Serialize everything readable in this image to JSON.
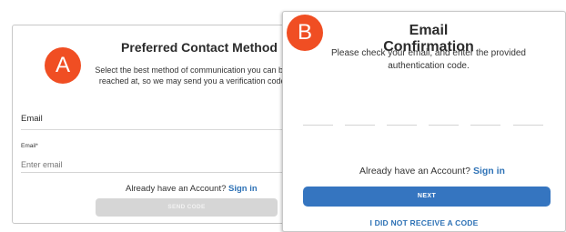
{
  "badges": {
    "a": "A",
    "b": "B"
  },
  "contact_method": {
    "title": "Preferred Contact Method",
    "description": "Select the best method of communication you can be reached at, so we may send you a verification code:",
    "selected_method": "Email",
    "email_field": {
      "label": "Email*",
      "placeholder": "Enter email",
      "value": ""
    },
    "account_prompt": "Already have an Account?",
    "sign_in_link": "Sign in",
    "send_code_button": "SEND CODE"
  },
  "email_confirmation": {
    "title": "Email Confirmation",
    "description": "Please check your email, and enter the provided authentication code.",
    "code_digits": [
      "",
      "",
      "",
      "",
      "",
      ""
    ],
    "account_prompt": "Already have an Account?",
    "sign_in_link": "Sign in",
    "next_button": "NEXT",
    "resend_link": "I DID NOT RECEIVE A CODE"
  },
  "colors": {
    "badge": "#f04e23",
    "primary_button": "#3575c0",
    "disabled_button": "#d6d6d6",
    "link": "#2e72b6"
  }
}
